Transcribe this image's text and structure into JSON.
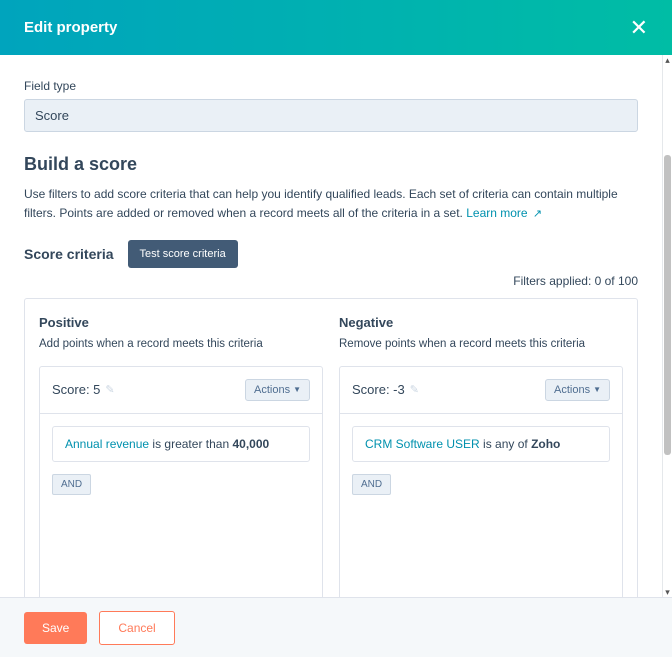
{
  "header": {
    "title": "Edit property",
    "close": "✕"
  },
  "field": {
    "label": "Field type",
    "value": "Score"
  },
  "build": {
    "title": "Build a score",
    "desc": "Use filters to add score criteria that can help you identify qualified leads. Each set of criteria can contain multiple filters. Points are added or removed when a record meets all of the criteria in a set. ",
    "learn_more": "Learn more "
  },
  "criteria": {
    "label": "Score criteria",
    "test_btn": "Test score criteria",
    "filters_applied": "Filters applied: 0 of 100"
  },
  "positive": {
    "title": "Positive",
    "desc": "Add points when a record meets this criteria",
    "score_label": "Score: 5",
    "actions": "Actions",
    "filter_field": "Annual revenue",
    "filter_op": " is greater than ",
    "filter_val": "40,000",
    "and": "AND"
  },
  "negative": {
    "title": "Negative",
    "desc": "Remove points when a record meets this criteria",
    "score_label": "Score: -3",
    "actions": "Actions",
    "filter_field": "CRM Software USER",
    "filter_op": " is any of ",
    "filter_val": "Zoho",
    "and": "AND"
  },
  "footer": {
    "save": "Save",
    "cancel": "Cancel"
  }
}
